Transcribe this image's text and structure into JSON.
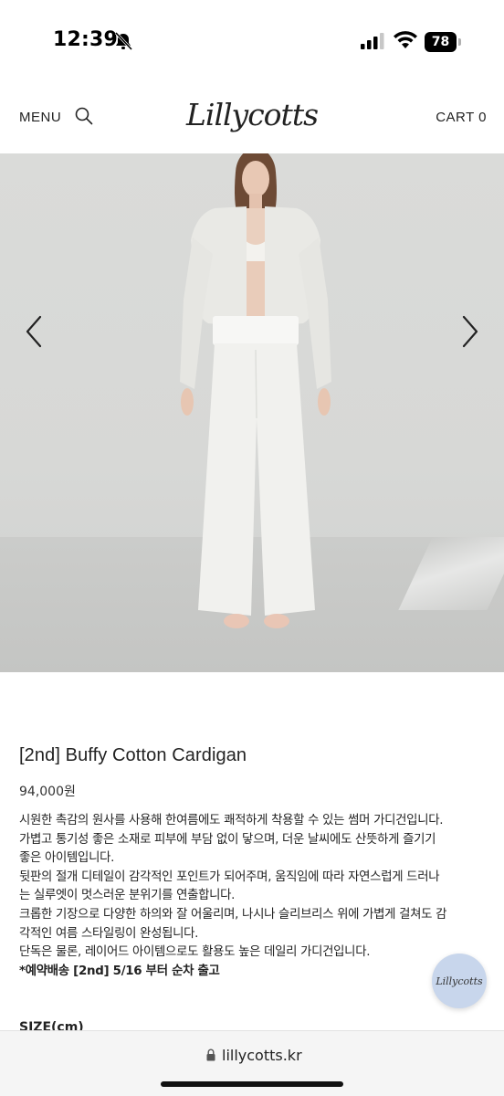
{
  "status_bar": {
    "time": "12:39",
    "battery": "78",
    "icons": [
      "bell-slash-icon",
      "signal-icon",
      "wifi-icon",
      "battery-icon"
    ]
  },
  "header": {
    "menu_label": "MENU",
    "logo_text": "Lillycotts",
    "cart_label": "CART 0"
  },
  "hero": {
    "prev_icon": "chevron-left-icon",
    "next_icon": "chevron-right-icon"
  },
  "product": {
    "title": "[2nd] Buffy Cotton Cardigan",
    "price": "94,000원",
    "description_lines": [
      "시원한 촉감의 원사를 사용해 한여름에도 쾌적하게 착용할 수 있는 썸머 가디건입니다.",
      "가볍고 통기성 좋은 소재로 피부에 부담 없이 닿으며, 더운 날씨에도 산뜻하게 즐기기",
      "좋은 아이템입니다.",
      "뒷판의 절개 디테일이 감각적인 포인트가 되어주며, 움직임에 따라 자연스럽게 드러나",
      "는 실루엣이 멋스러운 분위기를 연출합니다.",
      "크롭한 기장으로 다양한 하의와 잘 어울리며, 나시나 슬리브리스 위에 가볍게 걸쳐도 감",
      "각적인 여름 스타일링이 완성됩니다.",
      "단독은 물론, 레이어드 아이템으로도 활용도 높은 데일리 가디건입니다."
    ],
    "notice": "*예약배송 [2nd] 5/16 부터 순차 출고",
    "size_label": "SIZE(cm)"
  },
  "floating_button": {
    "label": "Lillycotts"
  },
  "browser": {
    "url": "lillycotts.kr"
  }
}
